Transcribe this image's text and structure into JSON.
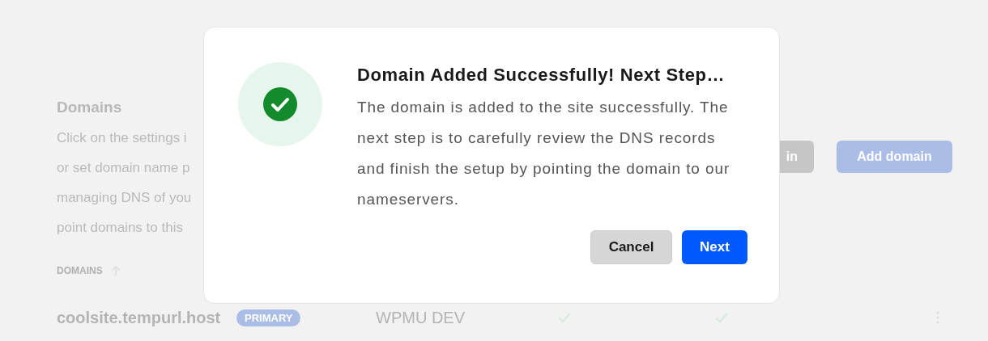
{
  "background": {
    "title": "Domains",
    "description_lines": [
      "Click on the settings i",
      "or set domain name p",
      "managing DNS of you",
      "point domains to this"
    ],
    "buttons": [
      {
        "label": "in",
        "kind": "secondary"
      },
      {
        "label": "Add domain",
        "kind": "primary"
      }
    ],
    "table": {
      "column_header": "DOMAINS",
      "rows": [
        {
          "domain": "coolsite.tempurl.host",
          "badge": "PRIMARY",
          "provider": "WPMU DEV",
          "checks": [
            {
              "checked": true
            },
            {
              "checked": true
            }
          ]
        }
      ]
    }
  },
  "dialog": {
    "title": "Domain Added Successfully! Next Step…",
    "message": "The domain is added to the site successfully. The next step is to carefully review the DNS records and finish the setup by pointing the domain to our nameservers.",
    "buttons": [
      {
        "label": "Cancel",
        "kind": "secondary"
      },
      {
        "label": "Next",
        "kind": "primary"
      }
    ]
  }
}
